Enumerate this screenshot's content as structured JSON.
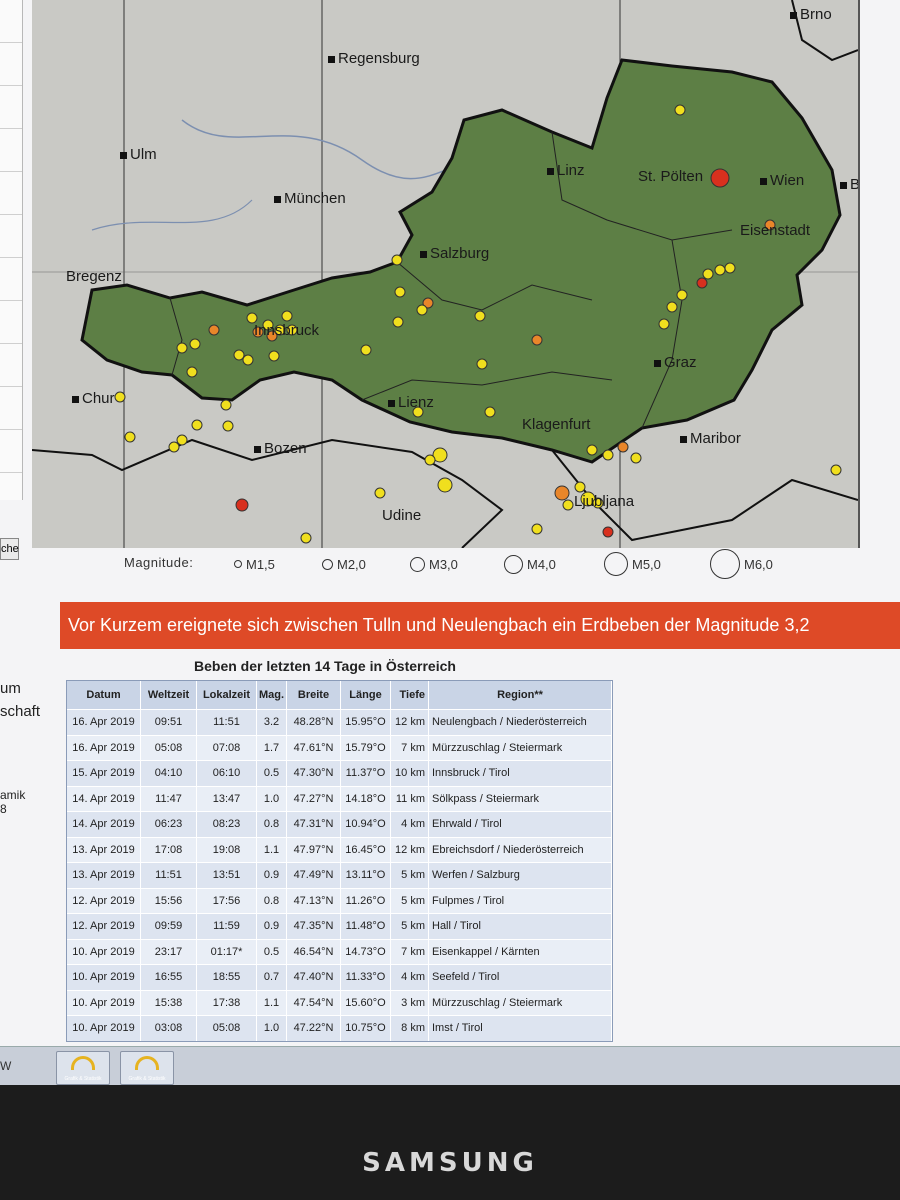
{
  "map": {
    "cities": [
      {
        "name": "Brno"
      },
      {
        "name": "Regensburg"
      },
      {
        "name": "Ulm"
      },
      {
        "name": "Linz"
      },
      {
        "name": "St. Pölten"
      },
      {
        "name": "Wien"
      },
      {
        "name": "Bra"
      },
      {
        "name": "München"
      },
      {
        "name": "Salzburg"
      },
      {
        "name": "Eisenstadt"
      },
      {
        "name": "Bregenz"
      },
      {
        "name": "Innsbruck"
      },
      {
        "name": "Graz"
      },
      {
        "name": "Chur"
      },
      {
        "name": "Lienz"
      },
      {
        "name": "Klagenfurt"
      },
      {
        "name": "Maribor"
      },
      {
        "name": "Bozen"
      },
      {
        "name": "Ljubljana"
      },
      {
        "name": "Udine"
      }
    ],
    "colors": {
      "austria": "#5d7f45",
      "surrounding": "#cbcbc5",
      "border": "#111111",
      "small_quake": "#f0df1e",
      "medium_quake": "#e9862a",
      "large_quake": "#d8301e"
    }
  },
  "legend": {
    "label": "Magnitude:",
    "items": [
      "M1,5",
      "M2,0",
      "M3,0",
      "M4,0",
      "M5,0",
      "M6,0"
    ]
  },
  "sidebar": {
    "button_label": "che",
    "text1": "um",
    "text2": "schaft",
    "text3": "amik",
    "text4": "8"
  },
  "banner": {
    "text": "Vor Kurzem ereignete sich zwischen Tulln und Neulengbach ein Erdbeben der Magnitude 3,2"
  },
  "table": {
    "title": "Beben der letzten 14 Tage in Österreich",
    "headers": [
      "Datum",
      "Weltzeit",
      "Lokalzeit",
      "Mag.",
      "Breite",
      "Länge",
      "Tiefe",
      "Region**"
    ],
    "rows": [
      [
        "16. Apr 2019",
        "09:51",
        "11:51",
        "3.2",
        "48.28°N",
        "15.95°O",
        "12 km",
        "Neulengbach / Niederösterreich"
      ],
      [
        "16. Apr 2019",
        "05:08",
        "07:08",
        "1.7",
        "47.61°N",
        "15.79°O",
        "7 km",
        "Mürzzuschlag / Steiermark"
      ],
      [
        "15. Apr 2019",
        "04:10",
        "06:10",
        "0.5",
        "47.30°N",
        "11.37°O",
        "10 km",
        "Innsbruck / Tirol"
      ],
      [
        "14. Apr 2019",
        "11:47",
        "13:47",
        "1.0",
        "47.27°N",
        "14.18°O",
        "11 km",
        "Sölkpass / Steiermark"
      ],
      [
        "14. Apr 2019",
        "06:23",
        "08:23",
        "0.8",
        "47.31°N",
        "10.94°O",
        "4 km",
        "Ehrwald / Tirol"
      ],
      [
        "13. Apr 2019",
        "17:08",
        "19:08",
        "1.1",
        "47.97°N",
        "16.45°O",
        "12 km",
        "Ebreichsdorf / Niederösterreich"
      ],
      [
        "13. Apr 2019",
        "11:51",
        "13:51",
        "0.9",
        "47.49°N",
        "13.11°O",
        "5 km",
        "Werfen / Salzburg"
      ],
      [
        "12. Apr 2019",
        "15:56",
        "17:56",
        "0.8",
        "47.13°N",
        "11.26°O",
        "5 km",
        "Fulpmes / Tirol"
      ],
      [
        "12. Apr 2019",
        "09:59",
        "11:59",
        "0.9",
        "47.35°N",
        "11.48°O",
        "5 km",
        "Hall / Tirol"
      ],
      [
        "10. Apr 2019",
        "23:17",
        "01:17*",
        "0.5",
        "46.54°N",
        "14.73°O",
        "7 km",
        "Eisenkappel / Kärnten"
      ],
      [
        "10. Apr 2019",
        "16:55",
        "18:55",
        "0.7",
        "47.40°N",
        "11.33°O",
        "4 km",
        "Seefeld / Tirol"
      ],
      [
        "10. Apr 2019",
        "15:38",
        "17:38",
        "1.1",
        "47.54°N",
        "15.60°O",
        "3 km",
        "Mürzzuschlag / Steiermark"
      ],
      [
        "10. Apr 2019",
        "03:08",
        "05:08",
        "1.0",
        "47.22°N",
        "10.75°O",
        "8 km",
        "Imst / Tirol"
      ]
    ]
  },
  "taskbar": {
    "left_text": "W",
    "btn_caption": "Grafik & Statistik"
  },
  "monitor": {
    "brand": "SAMSUNG"
  }
}
